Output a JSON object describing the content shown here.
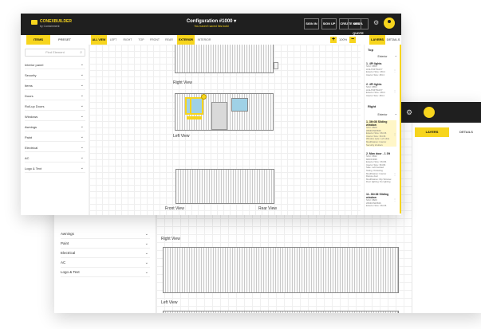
{
  "back_window": {
    "tabs": [
      "LAYERS",
      "DETAILS"
    ],
    "categories": [
      "Awnings",
      "Paint",
      "Electrical",
      "AC",
      "Logo & Text"
    ],
    "views": [
      "Right View",
      "Left View"
    ]
  },
  "front_window": {
    "logo": {
      "name": "CONEXBUILDER",
      "tagline": "by Containment"
    },
    "config": {
      "title": "Configuration #1000 ▾",
      "subtitle": "You haven't saved this build"
    },
    "top_buttons": [
      "SIGN IN",
      "SIGN UP",
      "CREATE NEW",
      "GET A QUOTE"
    ],
    "left_tabs": [
      "ITEMS",
      "PRESET"
    ],
    "view_tabs": [
      "ALL VIEW",
      "LEFT",
      "RIGHT",
      "TOP",
      "FRONT",
      "REAR",
      "EXTERIOR",
      "INTERIOR"
    ],
    "zoom": "100%",
    "right_tabs": [
      "LAYERS",
      "DETAILS"
    ],
    "search_placeholder": "Find Element",
    "categories": [
      "Interior panel",
      "Security",
      "Items",
      "Doors",
      "Roll-up Doors",
      "Windows",
      "Awnings",
      "Paint",
      "Electrical",
      "AC",
      "Logo & Text"
    ],
    "canvas_labels": {
      "right_view": "Right View",
      "left_view": "Left View",
      "front_view": "Front View",
      "rear_view": "Rear View"
    },
    "layers": {
      "top": "Top",
      "exterior": "Exterior",
      "right": "Right",
      "items_top": [
        {
          "title": "1. 4Ft lights",
          "lines": [
            "SKU: 9853",
            "LIGHT4FTNAVY",
            "Exterior Size: 48×4",
            "Interior Size: 48×4"
          ]
        },
        {
          "title": "2. 4Ft lights",
          "lines": [
            "SKU: 9853",
            "LIGHT4FTNAVY",
            "Exterior Size: 48×4",
            "Interior Size: 48×4"
          ]
        }
      ],
      "items_right": [
        {
          "title": "1. 36×36 Sliding window",
          "lines": [
            "SKU: 9829",
            "WINDOW3636",
            "Exterior Size: 36×36",
            "Interior Size: 36×36",
            "Window style: Left slide",
            "Modification: Interior",
            "Security shutters"
          ]
        },
        {
          "title": "2. Man door - 1 3ft",
          "lines": [
            "SKU: 9832",
            "MDOOR36",
            "Exterior Size: 36×84",
            "Interior Size: 36×84",
            "Side: Left handed",
            "Swing: Outswing",
            "Modification: Interior",
            "Deluxe door",
            "Modification: Rip Window",
            "Door lighting: No lighting"
          ]
        },
        {
          "title": "11. 36×36 Sliding window",
          "lines": [
            "SKU: 9829",
            "WINDOW3636",
            "Exterior Size: 36×36"
          ]
        }
      ]
    }
  }
}
